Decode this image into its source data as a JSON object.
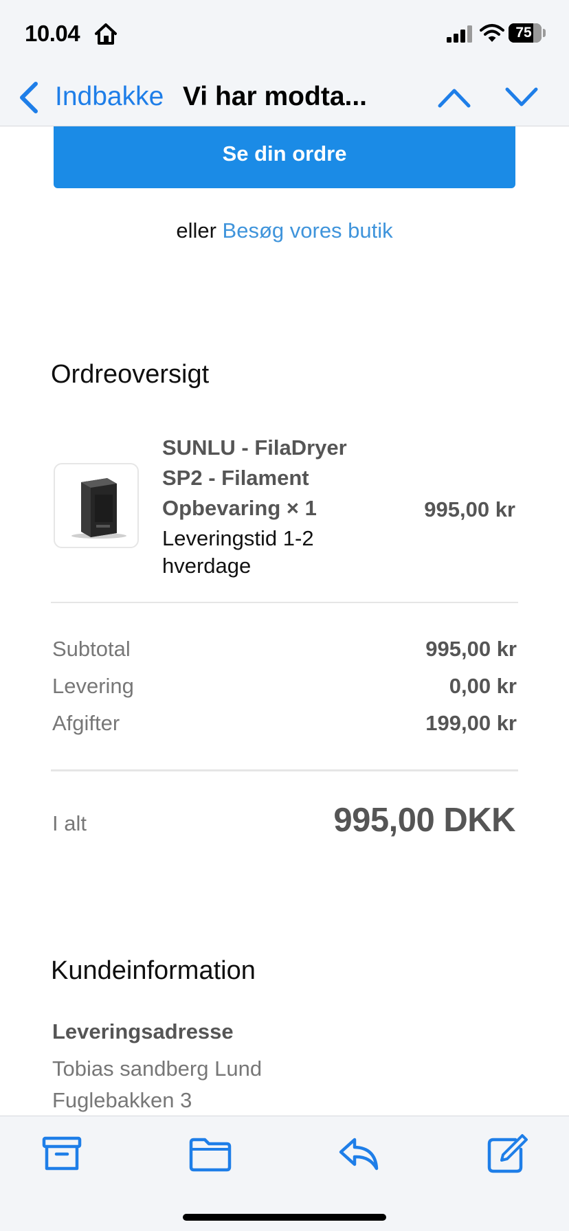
{
  "status_bar": {
    "time": "10.04",
    "battery_level": "75",
    "battery_fraction": 0.75,
    "icons": [
      "home-icon",
      "signal-icon",
      "wifi-icon",
      "battery-icon"
    ]
  },
  "nav": {
    "back_label": "Indbakke",
    "title": "Vi har modta...",
    "icons": [
      "chevron-left-icon",
      "chevron-up-icon",
      "chevron-down-icon"
    ]
  },
  "email": {
    "view_order_button": "Se din ordre",
    "or_text": "eller",
    "shop_link": "Besøg vores butik",
    "order_summary_title": "Ordreoversigt",
    "product": {
      "name": "SUNLU - FilaDryer SP2 - Filament Opbevaring × 1",
      "delivery": "Leveringstid 1-2 hverdage",
      "price": "995,00 kr"
    },
    "summary": [
      {
        "label": "Subtotal",
        "value": "995,00 kr"
      },
      {
        "label": "Levering",
        "value": "0,00 kr"
      },
      {
        "label": "Afgifter",
        "value": "199,00 kr"
      }
    ],
    "total": {
      "label": "I alt",
      "value": "995,00 DKK"
    },
    "customer_info_title": "Kundeinformation",
    "shipping_address": {
      "heading": "Leveringsadresse",
      "name": "Tobias sandberg Lund",
      "street": "Fuglebakken 3"
    }
  },
  "toolbar": {
    "icons": [
      "archive-icon",
      "folder-icon",
      "reply-icon",
      "compose-icon"
    ]
  },
  "colors": {
    "accent": "#1e7ee8",
    "button_bg": "#1b8be6",
    "link": "#3f94db",
    "bar_bg": "#f3f5f8"
  }
}
